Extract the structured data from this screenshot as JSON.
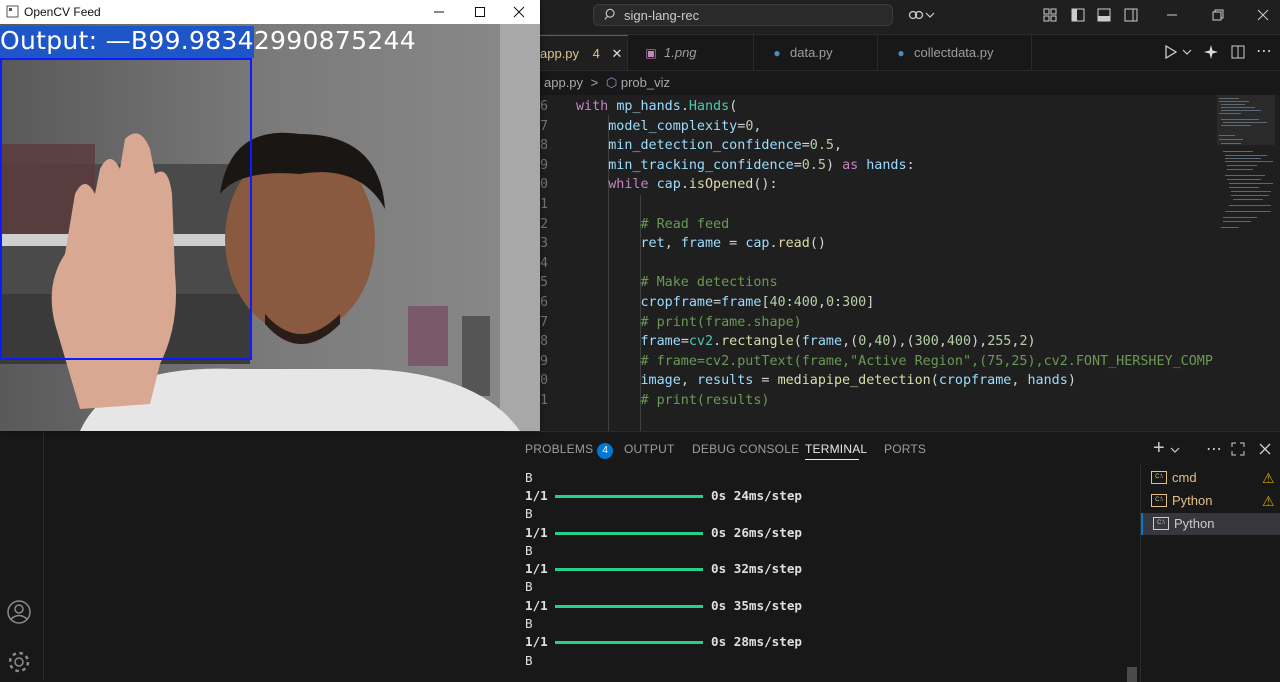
{
  "cv_window": {
    "title": "OpenCV Feed",
    "output_text": "Output: —B99.98342990875244",
    "colors": {
      "roi_box": "#0d1bff",
      "text_bg": "#1e56c8"
    }
  },
  "vscode": {
    "search": "sign-lang-rec",
    "tabs": [
      {
        "label": "app.py",
        "badge": "4",
        "icon": "python-icon",
        "active": true
      },
      {
        "label": "1.png",
        "icon": "image-icon"
      },
      {
        "label": "data.py",
        "icon": "python-icon"
      },
      {
        "label": "collectdata.py",
        "icon": "python-icon"
      }
    ],
    "breadcrumb": {
      "file": "app.py",
      "sep": ">",
      "symbol": "prob_viz"
    },
    "code_lines": [
      {
        "n": "6"
      },
      {
        "n": "7"
      },
      {
        "n": "8"
      },
      {
        "n": "9"
      },
      {
        "n": "0"
      },
      {
        "n": "1"
      },
      {
        "n": "2"
      },
      {
        "n": "3"
      },
      {
        "n": "4"
      },
      {
        "n": "5"
      },
      {
        "n": "6"
      },
      {
        "n": "7"
      },
      {
        "n": "8"
      },
      {
        "n": "9"
      },
      {
        "n": "0"
      },
      {
        "n": "1"
      }
    ],
    "panel": {
      "tabs": {
        "problems": "PROBLEMS",
        "problems_count": "4",
        "output": "OUTPUT",
        "debug": "DEBUG CONSOLE",
        "terminal": "TERMINAL",
        "ports": "PORTS"
      },
      "terminal_lines": [
        {
          "kind": "label",
          "text": "B"
        },
        {
          "kind": "progress",
          "step": "1/1",
          "time": "0s 24ms/step"
        },
        {
          "kind": "label",
          "text": "B"
        },
        {
          "kind": "progress",
          "step": "1/1",
          "time": "0s 26ms/step"
        },
        {
          "kind": "label",
          "text": "B"
        },
        {
          "kind": "progress",
          "step": "1/1",
          "time": "0s 32ms/step"
        },
        {
          "kind": "label",
          "text": "B"
        },
        {
          "kind": "progress",
          "step": "1/1",
          "time": "0s 35ms/step"
        },
        {
          "kind": "label",
          "text": "B"
        },
        {
          "kind": "progress",
          "step": "1/1",
          "time": "0s 28ms/step"
        },
        {
          "kind": "label",
          "text": "B"
        }
      ],
      "terminals": [
        {
          "name": "cmd",
          "warning": true,
          "color": "#e2c08d"
        },
        {
          "name": "Python",
          "warning": true,
          "color": "#e2c08d"
        },
        {
          "name": "Python",
          "warning": false,
          "color": "#cccccc",
          "active": true
        }
      ],
      "progress_color": "#23d18b"
    },
    "accent": "#0078d4"
  }
}
